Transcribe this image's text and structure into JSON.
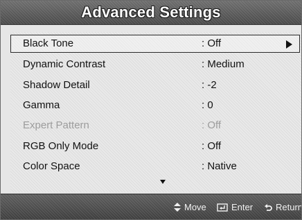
{
  "title": "Advanced Settings",
  "menu": {
    "items": [
      {
        "label": "Black Tone",
        "value": ": Off",
        "selected": true,
        "disabled": false
      },
      {
        "label": "Dynamic Contrast",
        "value": ": Medium",
        "selected": false,
        "disabled": false
      },
      {
        "label": "Shadow Detail",
        "value": ": -2",
        "selected": false,
        "disabled": false
      },
      {
        "label": "Gamma",
        "value": ": 0",
        "selected": false,
        "disabled": false
      },
      {
        "label": "Expert Pattern",
        "value": ": Off",
        "selected": false,
        "disabled": true
      },
      {
        "label": "RGB Only Mode",
        "value": ": Off",
        "selected": false,
        "disabled": false
      },
      {
        "label": "Color Space",
        "value": ": Native",
        "selected": false,
        "disabled": false
      }
    ]
  },
  "footer": {
    "move": "Move",
    "enter": "Enter",
    "return": "Return"
  },
  "icons": {
    "submenu": "chevron-right-icon",
    "scroll": "scroll-down-icon",
    "move": "updown-arrow-icon",
    "enter": "enter-icon",
    "return": "return-icon"
  }
}
